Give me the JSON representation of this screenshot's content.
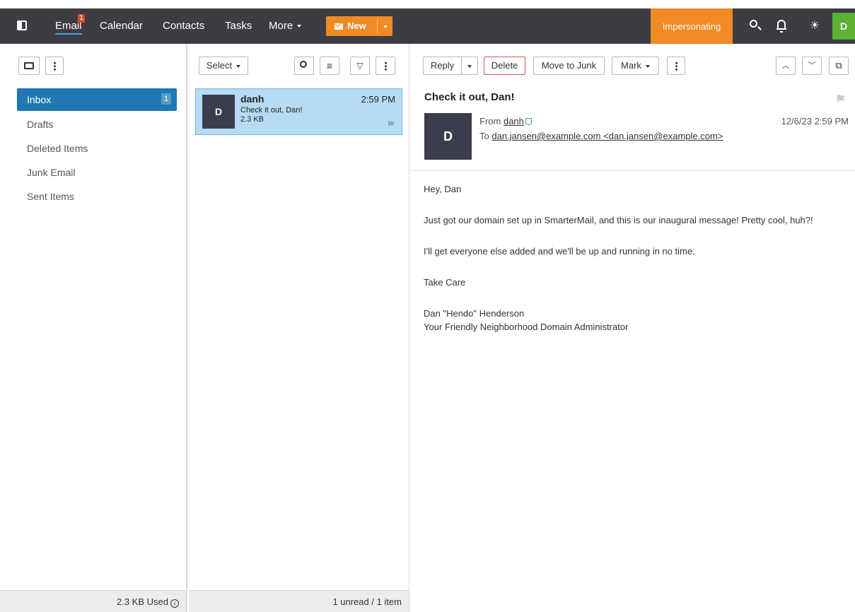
{
  "nav": {
    "email": "Email",
    "email_badge": "1",
    "calendar": "Calendar",
    "contacts": "Contacts",
    "tasks": "Tasks",
    "more": "More",
    "new_label": "New",
    "impersonating": "Impersonating",
    "user_initial": "D"
  },
  "folders": {
    "items": [
      {
        "label": "Inbox",
        "count": "1"
      },
      {
        "label": "Drafts"
      },
      {
        "label": "Deleted Items"
      },
      {
        "label": "Junk Email"
      },
      {
        "label": "Sent Items"
      }
    ],
    "footer": "2.3 KB Used"
  },
  "list": {
    "select_label": "Select",
    "message": {
      "initial": "D",
      "from": "danh",
      "time": "2:59 PM",
      "subject": "Check it out, Dan!",
      "size": "2.3 KB"
    },
    "footer": "1 unread / 1 item"
  },
  "reader": {
    "toolbar": {
      "reply": "Reply",
      "delete": "Delete",
      "move_to_junk": "Move to Junk",
      "mark": "Mark"
    },
    "subject": "Check it out, Dan!",
    "initial": "D",
    "from_label": "From",
    "from": "danh",
    "to_label": "To",
    "to": "dan.jansen@example.com <dan.jansen@example.com>",
    "date": "12/6/23 2:59 PM",
    "body": [
      "Hey, Dan",
      "Just got our domain set up in SmarterMail, and this is our inaugural message! Pretty cool, huh?!",
      "I'll get everyone else added and we'll be up and running in no time.",
      "Take Care"
    ],
    "signature": {
      "name": "Dan \"Hendo\" Henderson",
      "title": "Your Friendly Neighborhood Domain Administrator"
    }
  },
  "colors": {
    "topbar": "#3b3d42",
    "accent_orange": "#f08a24",
    "selected_blue": "#1f78b4",
    "message_selected": "#b6dbf5",
    "avatar_green": "#5cb032"
  },
  "icons": [
    "sidebar-toggle-icon",
    "mail-icon",
    "search-icon",
    "bell-icon",
    "theme-toggle-icon",
    "folder-icon",
    "more-options-icon",
    "sort-icon",
    "filter-icon",
    "flag-icon",
    "verified-shield-icon",
    "chevron-up-icon",
    "chevron-down-icon",
    "pop-out-icon",
    "info-icon"
  ]
}
